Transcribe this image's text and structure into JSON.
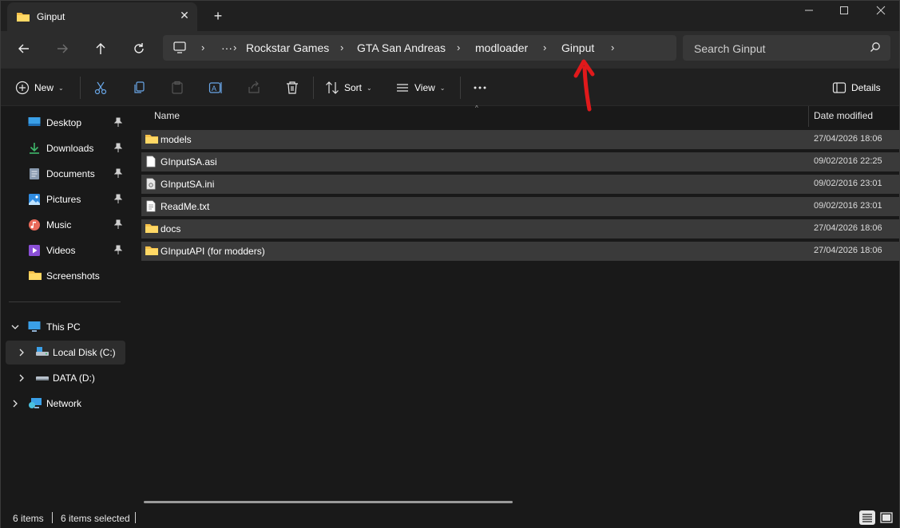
{
  "tab": {
    "title": "Ginput",
    "icon": "folder-icon"
  },
  "window_controls": [
    "minimize",
    "maximize",
    "close"
  ],
  "address": {
    "breadcrumbs": [
      "Rockstar Games",
      "GTA San Andreas",
      "modloader",
      "Ginput"
    ],
    "overflow": "···"
  },
  "search": {
    "placeholder": "Search Ginput"
  },
  "commands": {
    "new": "New",
    "sort": "Sort",
    "view": "View",
    "more": "···",
    "details": "Details"
  },
  "sidebar": {
    "quick_access": [
      {
        "label": "Desktop",
        "icon": "desktop-icon",
        "pinned": true
      },
      {
        "label": "Downloads",
        "icon": "download-icon",
        "pinned": true
      },
      {
        "label": "Documents",
        "icon": "documents-icon",
        "pinned": true
      },
      {
        "label": "Pictures",
        "icon": "pictures-icon",
        "pinned": true
      },
      {
        "label": "Music",
        "icon": "music-icon",
        "pinned": true
      },
      {
        "label": "Videos",
        "icon": "videos-icon",
        "pinned": true
      },
      {
        "label": "Screenshots",
        "icon": "folder-icon",
        "pinned": false
      }
    ],
    "tree": [
      {
        "label": "This PC",
        "icon": "pc-icon",
        "expanded": true
      },
      {
        "label": "Local Disk (C:)",
        "icon": "drive-c-icon",
        "selected": true
      },
      {
        "label": "DATA (D:)",
        "icon": "drive-icon"
      },
      {
        "label": "Network",
        "icon": "network-icon"
      }
    ]
  },
  "columns": {
    "name": "Name",
    "date_modified": "Date modified"
  },
  "files": [
    {
      "name": "models",
      "type": "folder",
      "date": "27/04/2026 18:06"
    },
    {
      "name": "GInputSA.asi",
      "type": "file",
      "date": "09/02/2016 22:25"
    },
    {
      "name": "GInputSA.ini",
      "type": "settings",
      "date": "09/02/2016 23:01"
    },
    {
      "name": "ReadMe.txt",
      "type": "text",
      "date": "09/02/2016 23:01"
    },
    {
      "name": "docs",
      "type": "folder",
      "date": "27/04/2026 18:06"
    },
    {
      "name": "GInputAPI (for modders)",
      "type": "folder",
      "date": "27/04/2026 18:06"
    }
  ],
  "status": {
    "items": "6 items",
    "selected": "6 items selected"
  },
  "colors": {
    "annotation_arrow": "#e0191b",
    "folder": "#f5c04a",
    "selection": "#3a3a3a"
  }
}
